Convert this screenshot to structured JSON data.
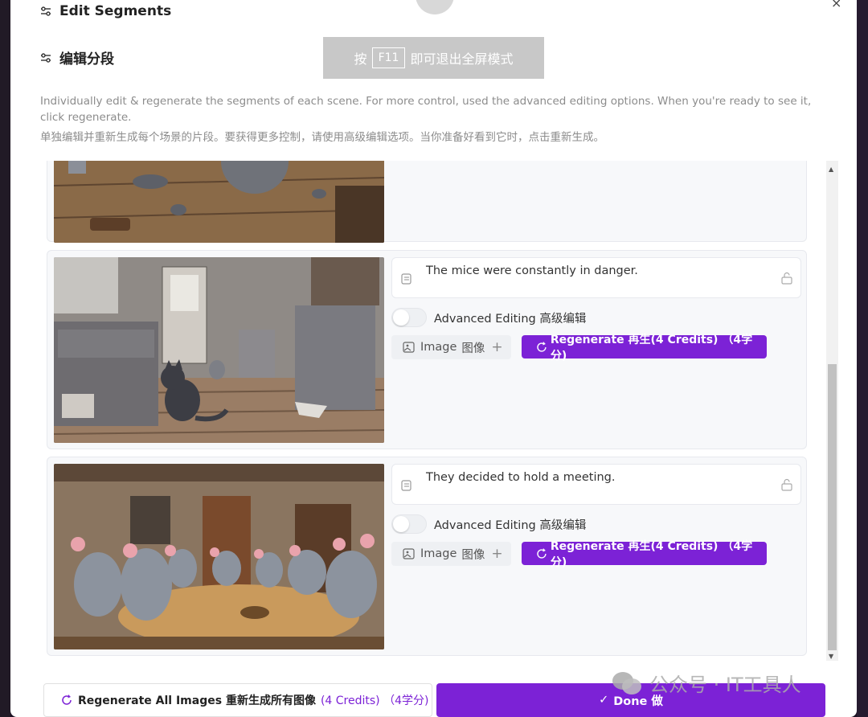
{
  "dialog": {
    "title_en": "Edit Segments",
    "title_zh": "编辑分段",
    "description_en": "Individually edit & regenerate the segments of each scene. For more control, used the advanced editing options. When you're ready to see it, click regenerate.",
    "description_zh": "单独编辑并重新生成每个场景的片段。要获得更多控制，请使用高级编辑选项。当你准备好看到它时，点击重新生成。",
    "close_symbol": "×"
  },
  "fullscreen_banner": {
    "prefix": "按",
    "key": "F11",
    "suffix": "即可退出全屏模式"
  },
  "segments": [
    {
      "caption": "The mice were constantly in danger.",
      "advanced_label": "Advanced Editing 高级编辑",
      "advanced_on": false,
      "image_label": "Image",
      "image_label_zh": "图像",
      "plus": "+",
      "regenerate_label": "Regenerate 再生(4 Credits) （4学分)"
    },
    {
      "caption": "They decided to hold a meeting.",
      "advanced_label": "Advanced Editing 高级编辑",
      "advanced_on": false,
      "image_label": "Image",
      "image_label_zh": "图像",
      "plus": "+",
      "regenerate_label": "Regenerate 再生(4 Credits) （4学分)"
    }
  ],
  "footer": {
    "regen_all_label": "Regenerate All Images 重新生成所有图像",
    "regen_all_credits": "(4 Credits) （4学分)",
    "done_check": "✓",
    "done_label": "Done 做"
  },
  "watermark": {
    "text": "公众号 · IT工具人"
  },
  "colors": {
    "accent": "#7c22d6",
    "muted_text": "#8c8c8c",
    "panel_bg": "#f7f8fa"
  }
}
